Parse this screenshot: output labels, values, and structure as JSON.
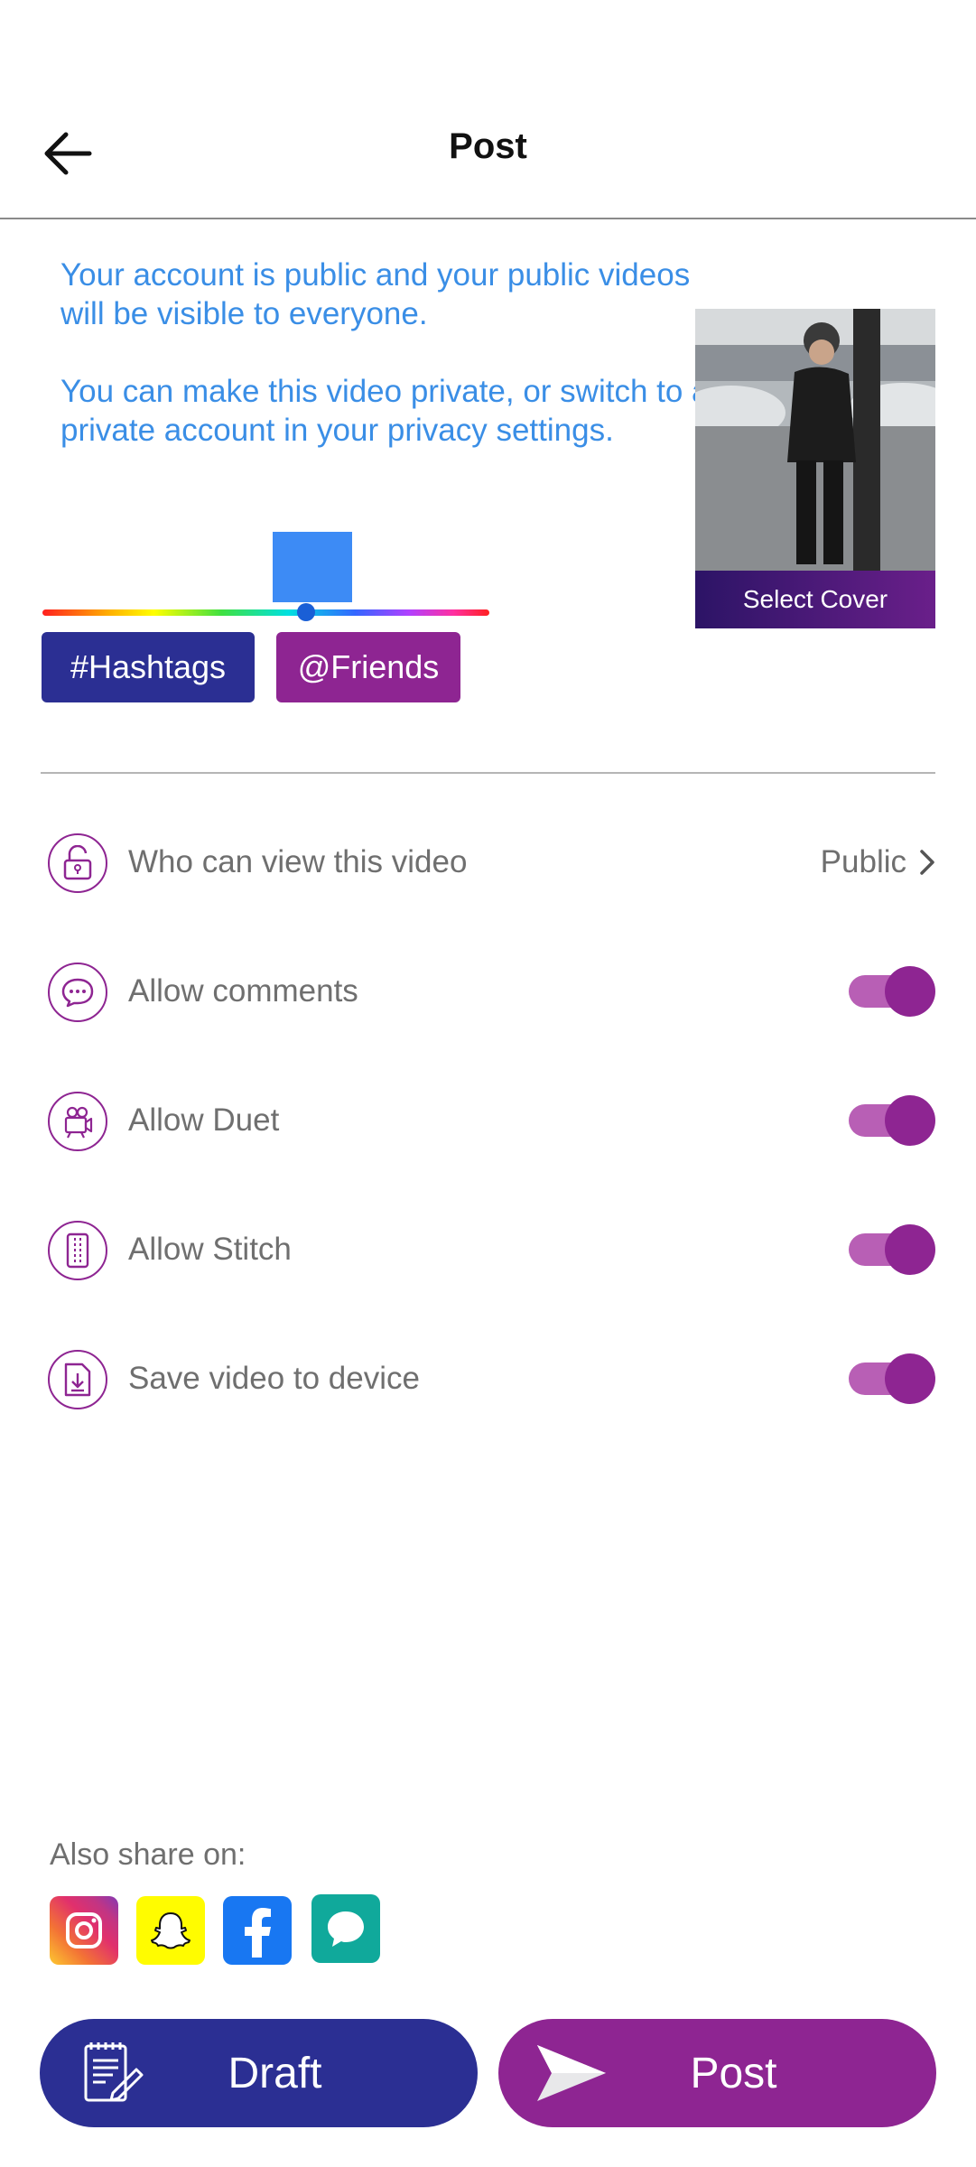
{
  "header": {
    "title": "Post",
    "back_icon": "arrow-left-icon"
  },
  "info": {
    "line1": "Your account is public and your public videos will be visible to everyone.",
    "line2": "You can make this video private, or switch to a private account in your privacy settings."
  },
  "cover": {
    "button_label": "Select Cover"
  },
  "text_color": {
    "selected": "#3d8bf5",
    "hue_position": 0.59
  },
  "chips": {
    "hashtags": "#Hashtags",
    "friends": "@Friends"
  },
  "settings": {
    "privacy": {
      "label": "Who can view this video",
      "value": "Public",
      "icon": "lock-icon"
    },
    "comments": {
      "label": "Allow comments",
      "enabled": true,
      "icon": "chat-bubble-icon"
    },
    "duet": {
      "label": "Allow Duet",
      "enabled": true,
      "icon": "video-camera-icon"
    },
    "stitch": {
      "label": "Allow Stitch",
      "enabled": true,
      "icon": "stitch-icon"
    },
    "save": {
      "label": "Save video to device",
      "enabled": true,
      "icon": "download-icon"
    }
  },
  "share": {
    "label": "Also share on:",
    "platforms": [
      "instagram-icon",
      "snapchat-icon",
      "facebook-icon",
      "message-icon"
    ]
  },
  "actions": {
    "draft": "Draft",
    "post": "Post"
  },
  "colors": {
    "accent": "#8e2592",
    "primary": "#2b2f93",
    "info_text": "#3a8ee6"
  }
}
